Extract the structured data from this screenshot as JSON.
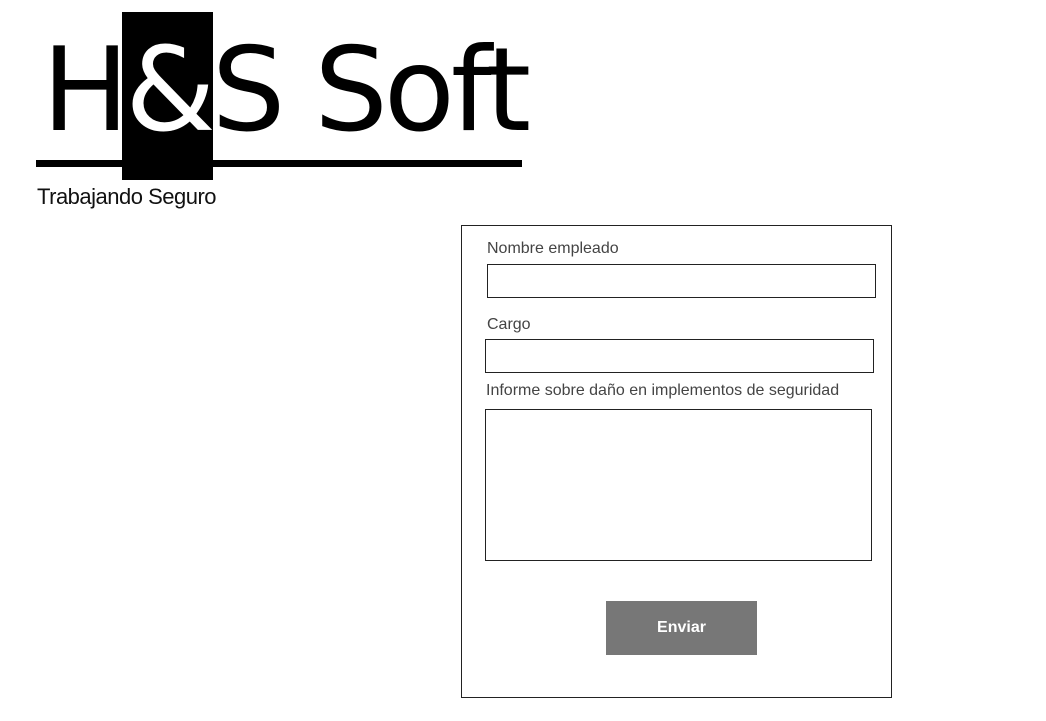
{
  "logo": {
    "part1": "H",
    "amp": "&",
    "part2": "S Soft"
  },
  "tagline": "Trabajando Seguro",
  "form": {
    "nombre_label": "Nombre empleado",
    "nombre_value": "",
    "cargo_label": "Cargo",
    "cargo_value": "",
    "informe_label": "Informe sobre daño en implementos de seguridad",
    "informe_value": "",
    "submit_label": "Enviar"
  },
  "colors": {
    "button_bg": "#777777",
    "button_text": "#ffffff",
    "border": "#222222"
  }
}
